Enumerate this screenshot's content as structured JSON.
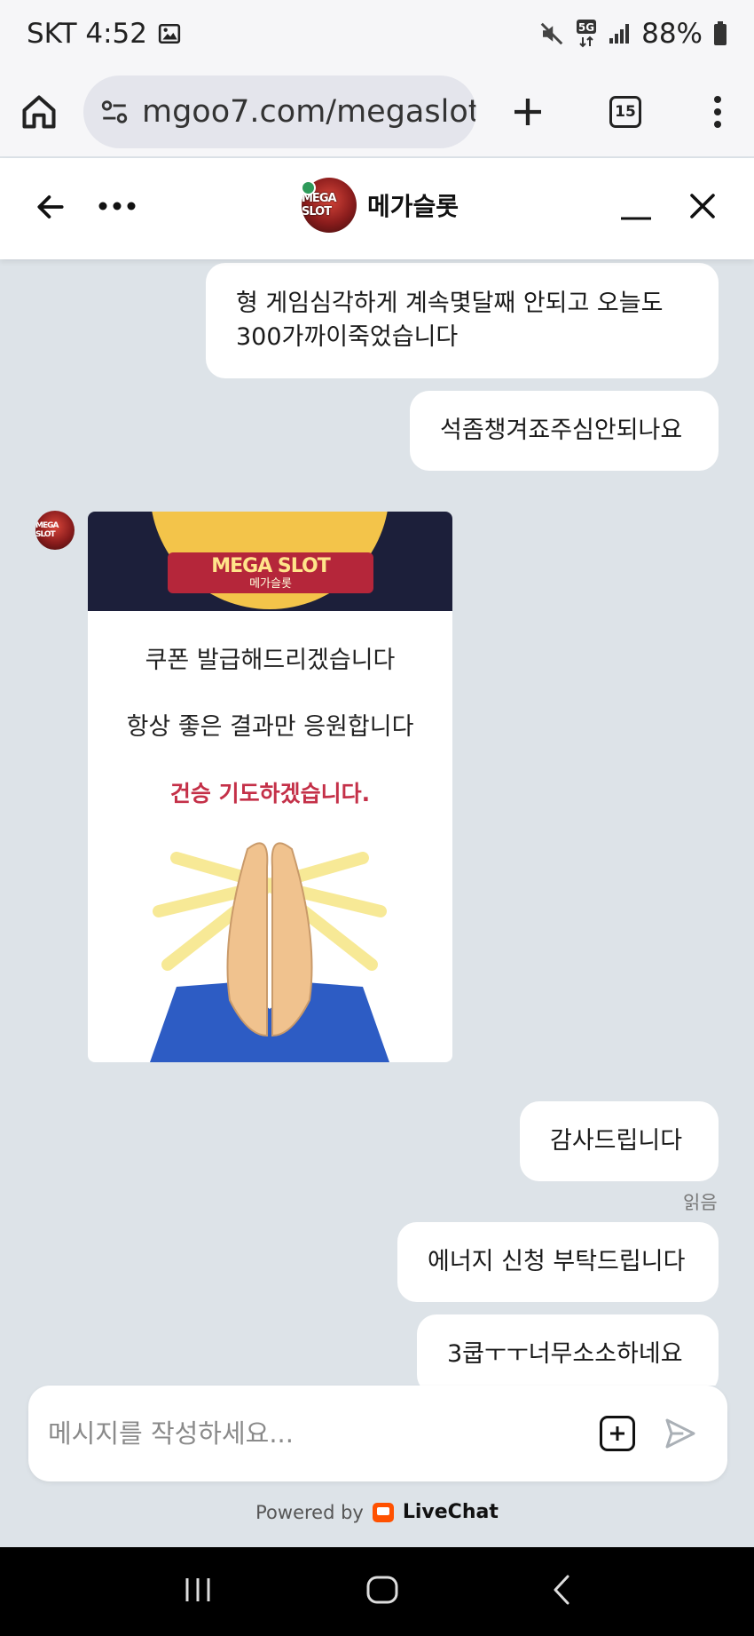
{
  "status_bar": {
    "carrier_time": "SKT 4:52",
    "network": "5G",
    "battery": "88%"
  },
  "browser": {
    "url": "mgoo7.com/megaslot",
    "tab_count": "15"
  },
  "chat_header": {
    "title": "메가슬롯",
    "avatar_text": "MEGA SLOT"
  },
  "messages": [
    {
      "from": "visitor",
      "text": "형 게임심각하게 계속몇달째 안되고 오늘도 300가까이죽었습니다"
    },
    {
      "from": "visitor",
      "text": "석좀챙겨죠주심안되나요"
    },
    {
      "from": "visitor",
      "text": "감사드립니다"
    },
    {
      "from": "visitor",
      "text": "에너지 신청 부탁드립니다"
    },
    {
      "from": "visitor",
      "text": "3쿱ㅜㅜ너무소소하네요"
    }
  ],
  "read_receipt": "읽음",
  "image_message": {
    "logo": "MEGA SLOT",
    "logo_sub": "메가슬롯",
    "line1": "쿠폰 발급해드리겠습니다",
    "line2": "항상 좋은 결과만 응원합니다",
    "line3": "건승 기도하겠습니다."
  },
  "composer": {
    "placeholder": "메시지를 작성하세요..."
  },
  "footer": {
    "powered_by": "Powered by",
    "brand": "LiveChat"
  },
  "colors": {
    "chat_background": "#dde3e8",
    "bubble": "#ffffff",
    "online": "#2e9a5a",
    "livechat_orange": "#ff5100"
  }
}
